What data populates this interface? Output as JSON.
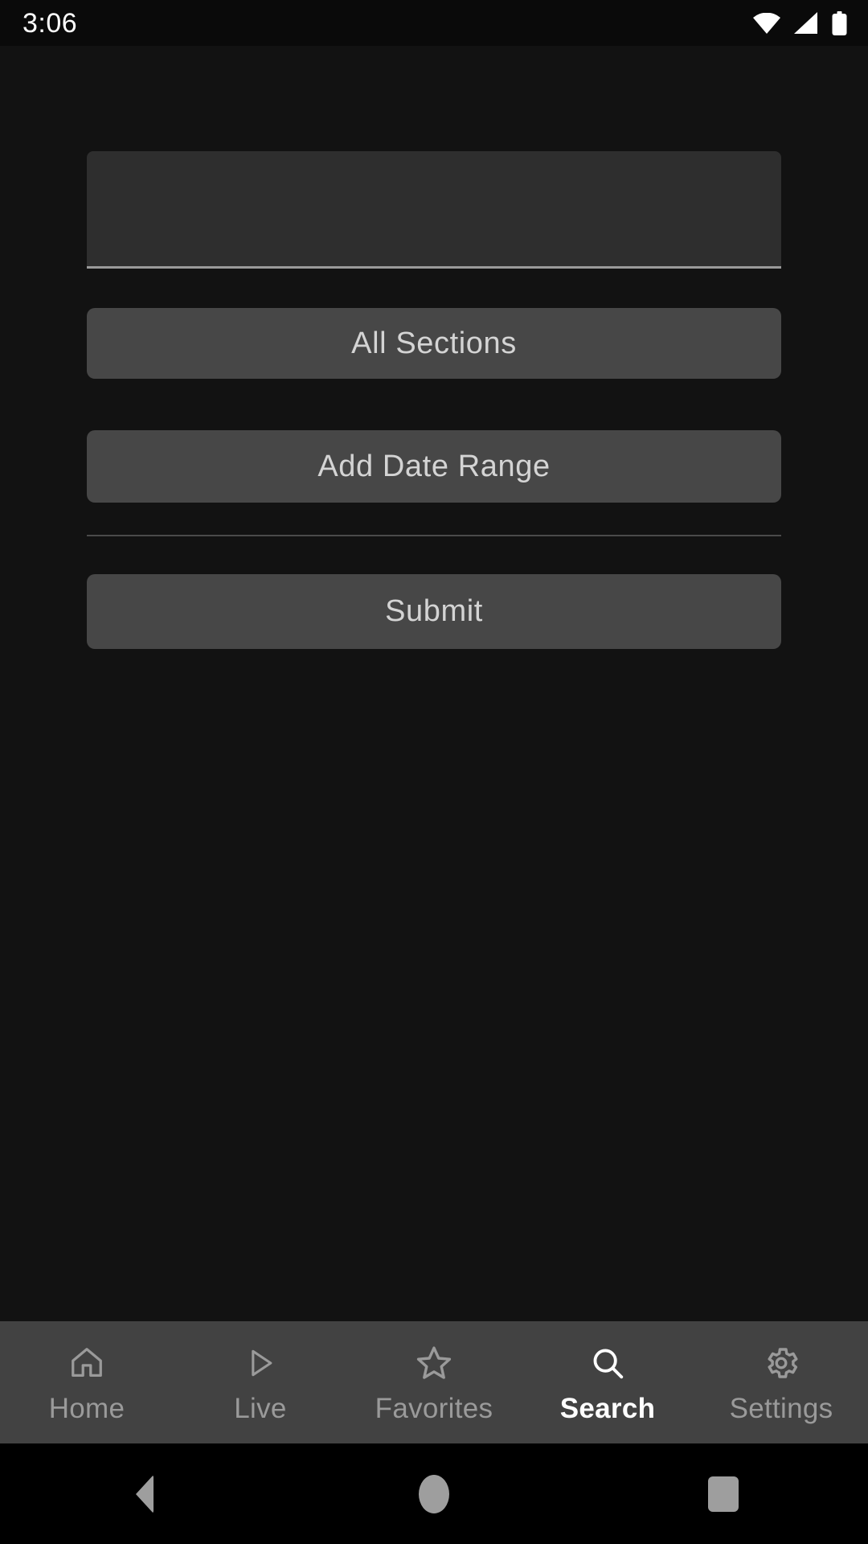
{
  "status_bar": {
    "clock": "3:06",
    "icons": [
      {
        "name": "wifi-icon",
        "label": "wifi"
      },
      {
        "name": "cellular-signal-icon",
        "label": "signal"
      },
      {
        "name": "battery-icon",
        "label": "battery"
      }
    ]
  },
  "search_form": {
    "query_input": {
      "value": "",
      "placeholder": ""
    },
    "sections_button_label": "All Sections",
    "date_range_button_label": "Add Date Range",
    "submit_button_label": "Submit"
  },
  "tab_bar": {
    "active_tab": "Search",
    "items": [
      {
        "label": "Home",
        "icon": "home-icon",
        "active": false
      },
      {
        "label": "Live",
        "icon": "play-icon",
        "active": false
      },
      {
        "label": "Favorites",
        "icon": "star-icon",
        "active": false
      },
      {
        "label": "Search",
        "icon": "search-icon",
        "active": true
      },
      {
        "label": "Settings",
        "icon": "gear-icon",
        "active": false
      }
    ]
  },
  "system_nav": {
    "back_label": "Back",
    "home_label": "Home",
    "recents_label": "Recents"
  },
  "colors": {
    "background": "#121212",
    "status_bar_background": "#0a0a0a",
    "field_background": "#2e2e2e",
    "button_background": "#474747",
    "button_text": "#d4d4d4",
    "tab_bar_background": "#424242",
    "tab_inactive": "#9a9a9a",
    "tab_active": "#ffffff",
    "divider": "#4a4a4a",
    "system_nav_background": "#000000"
  }
}
